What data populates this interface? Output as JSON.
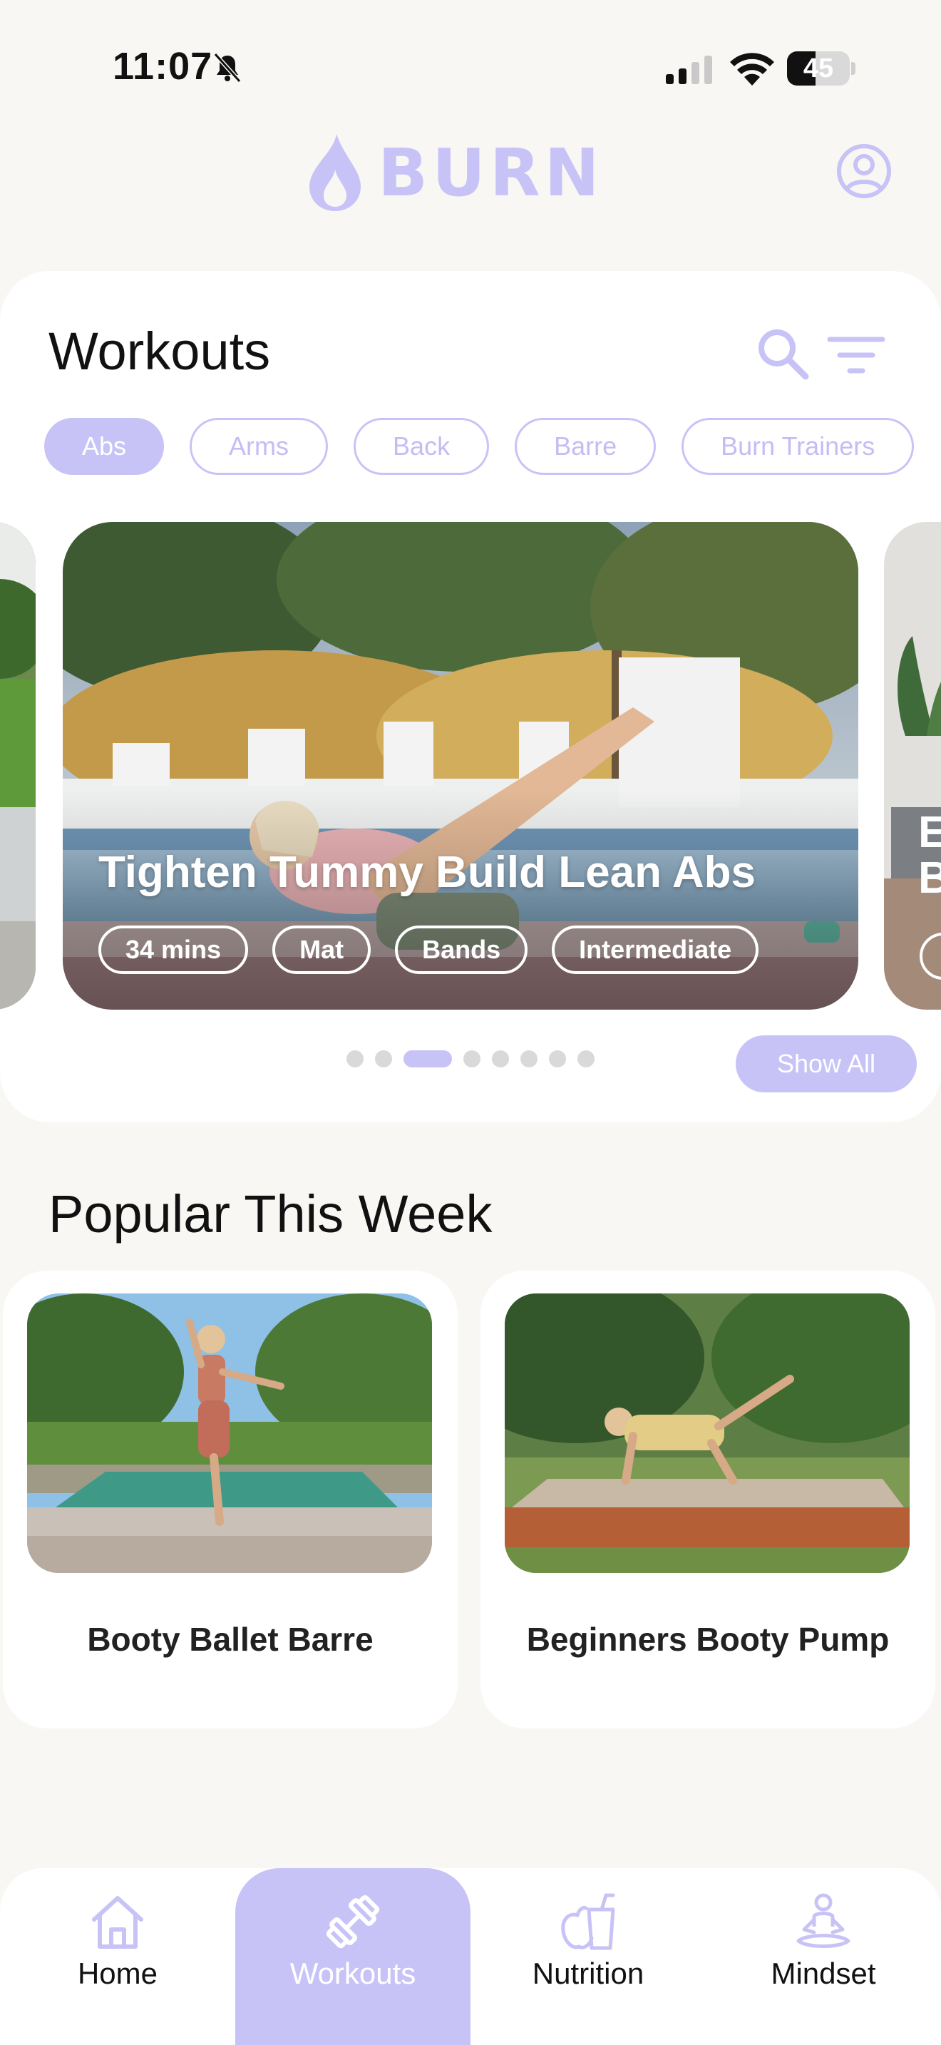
{
  "status_bar": {
    "time": "11:07",
    "battery": "45",
    "battery_fraction": 0.45,
    "icons": [
      "bell-slash-icon",
      "cellular-signal-icon",
      "wifi-icon",
      "battery-icon"
    ]
  },
  "header": {
    "brand": "BURN",
    "logo_icon": "flame-logo-icon",
    "account_icon": "user-circle-icon"
  },
  "workouts": {
    "title": "Workouts",
    "search_icon": "search-icon",
    "filter_icon": "filter-icon",
    "chips": [
      "Abs",
      "Arms",
      "Back",
      "Barre",
      "Burn Trainers"
    ],
    "active_chip": "Abs",
    "featured": {
      "title": "Tighten Tummy Build Lean Abs",
      "tags": [
        "34 mins",
        "Mat",
        "Bands",
        "Intermediate"
      ]
    },
    "next_peek_text": "E\nB",
    "carousel_pages": 8,
    "carousel_active_page": 3,
    "show_all": "Show All"
  },
  "popular": {
    "title": "Popular This Week",
    "items": [
      {
        "label": "Booty Ballet Barre"
      },
      {
        "label": "Beginners Booty Pump"
      }
    ]
  },
  "tab_bar": {
    "tabs": [
      {
        "label": "Home",
        "icon": "home-icon"
      },
      {
        "label": "Workouts",
        "icon": "dumbbell-icon"
      },
      {
        "label": "Nutrition",
        "icon": "apple-drink-icon"
      },
      {
        "label": "Mindset",
        "icon": "meditation-icon"
      }
    ],
    "active": "Workouts"
  },
  "colors": {
    "accent": "#c8c3f7",
    "background": "#f8f7f4",
    "card": "#ffffff",
    "text": "#111111"
  }
}
